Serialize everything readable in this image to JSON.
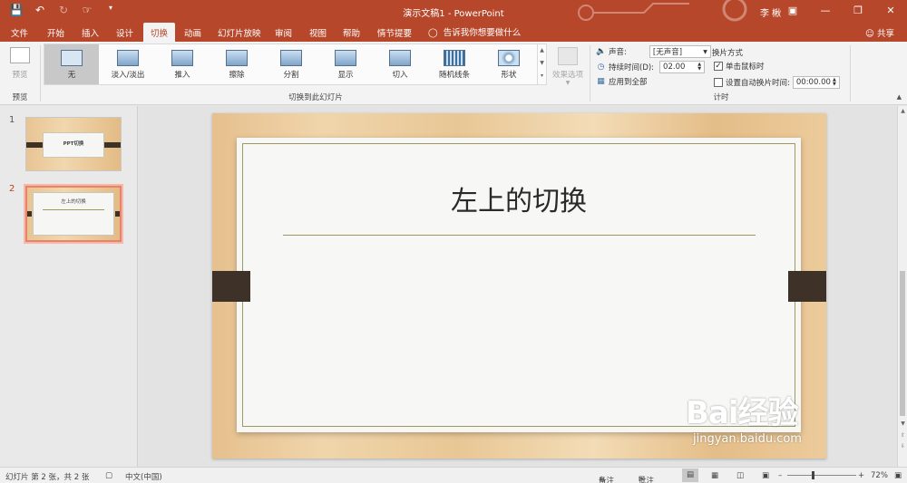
{
  "titlebar": {
    "title": "演示文稿1  -  PowerPoint",
    "user": "李 楸",
    "qat_icons": [
      "save-icon",
      "undo-icon",
      "redo-icon",
      "touch-mode-icon",
      "customize-icon"
    ],
    "window_buttons": [
      "ribbon-display-icon",
      "minimize-icon",
      "restore-icon",
      "close-icon"
    ]
  },
  "tabs": {
    "items": [
      "文件",
      "开始",
      "插入",
      "设计",
      "切换",
      "动画",
      "幻灯片放映",
      "审阅",
      "视图",
      "帮助",
      "情节提要"
    ],
    "active": "切换",
    "tell_me": "告诉我你想要做什么",
    "share": "共享"
  },
  "ribbon": {
    "preview_label": "预览",
    "preview_group": "预览",
    "transitions": [
      "无",
      "淡入/淡出",
      "推入",
      "擦除",
      "分割",
      "显示",
      "切入",
      "随机线条",
      "形状"
    ],
    "transitions_group": "切换到此幻灯片",
    "effect_options": "效果选项",
    "timing": {
      "sound_label": "声音:",
      "sound_value": "[无声音]",
      "duration_label": "持续时间(D):",
      "duration_value": "02.00",
      "apply_all": "应用到全部",
      "advance_label": "换片方式",
      "on_click": "单击鼠标时",
      "on_click_checked": true,
      "after_label": "设置自动换片时间:",
      "after_value": "00:00.00",
      "after_checked": false,
      "group": "计时"
    }
  },
  "slides": [
    {
      "number": "1",
      "title": "PPT切换"
    },
    {
      "number": "2",
      "title": "左上的切换"
    }
  ],
  "main_slide": {
    "title": "左上的切换"
  },
  "statusbar": {
    "slide_info": "幻灯片 第 2 张，共 2 张",
    "language": "中文(中国)",
    "notes": "备注",
    "comments": "批注",
    "zoom": "72%"
  },
  "watermark": {
    "text": "Bai经验",
    "url": "jingyan.baidu.com"
  }
}
